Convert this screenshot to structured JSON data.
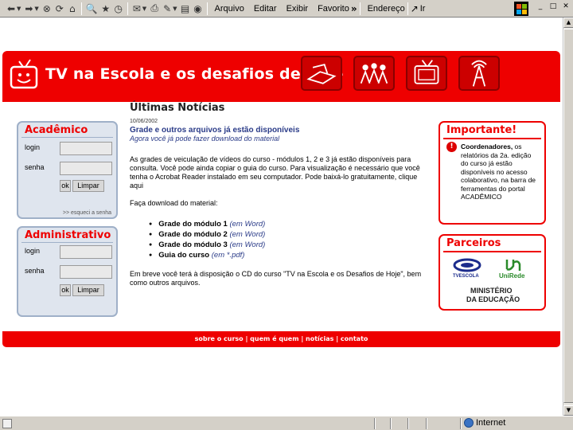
{
  "browser": {
    "menu": [
      "Arquivo",
      "Editar",
      "Exibir",
      "Favorito"
    ],
    "chevron": "»",
    "address_label": "Endereço",
    "go_label": "Ir",
    "status_zone": "Internet"
  },
  "site": {
    "title": "TV na Escola e os desafios de hoje",
    "footer_links": "sobre o curso | quem é quem | notícias | contato"
  },
  "academico": {
    "title": "Acadêmico",
    "login_label": "login",
    "senha_label": "senha",
    "ok_label": "ok",
    "clear_label": "Limpar",
    "forgot_label": ">> esqueci a senha"
  },
  "administrativo": {
    "title": "Administrativo",
    "login_label": "login",
    "senha_label": "senha",
    "ok_label": "ok",
    "clear_label": "Limpar"
  },
  "news": {
    "title": "Últimas Notícias",
    "date": "10/06/2002",
    "headline": "Grade e outros arquivos já estão disponíveis",
    "subheadline": "Agora você já pode fazer download do material",
    "paragraph": "As grades de veiculação de vídeos do curso - módulos 1, 2 e 3 já estão disponíveis para consulta. Você pode ainda copiar o guia do curso. Para visualização é necessário que você tenha o Acrobat Reader instalado em seu computador. Pode baixá-lo gratuitamente, clique aqui",
    "download_intro": "Faça download do material:",
    "items": [
      {
        "label": "Grade do módulo 1",
        "fmt": "(em Word)"
      },
      {
        "label": "Grade do módulo 2",
        "fmt": "(em Word)"
      },
      {
        "label": "Grade do módulo 3",
        "fmt": "(em Word)"
      },
      {
        "label": "Guia do curso",
        "fmt": "(em *.pdf)"
      }
    ],
    "closing": "Em breve você terá à disposição o CD do curso \"TV na Escola e os Desafios de Hoje\", bem como outros arquivos."
  },
  "importante": {
    "title": "Importante!",
    "text_bold": "Coordenadores,",
    "text": " os relatórios da 2a. edição do curso já estão disponíveis no acesso colaborativo, na barra de ferramentas do portal ACADÊMICO"
  },
  "parceiros": {
    "title": "Parceiros",
    "logo1": "TVESCOLA",
    "logo2": "UniRede",
    "logo3_line1": "MINISTÉRIO",
    "logo3_line2": "DA EDUCAÇÃO"
  },
  "colors": {
    "brand_red": "#e00000",
    "panel_blue": "#dfe5ee",
    "link_blue": "#2a3b88"
  }
}
